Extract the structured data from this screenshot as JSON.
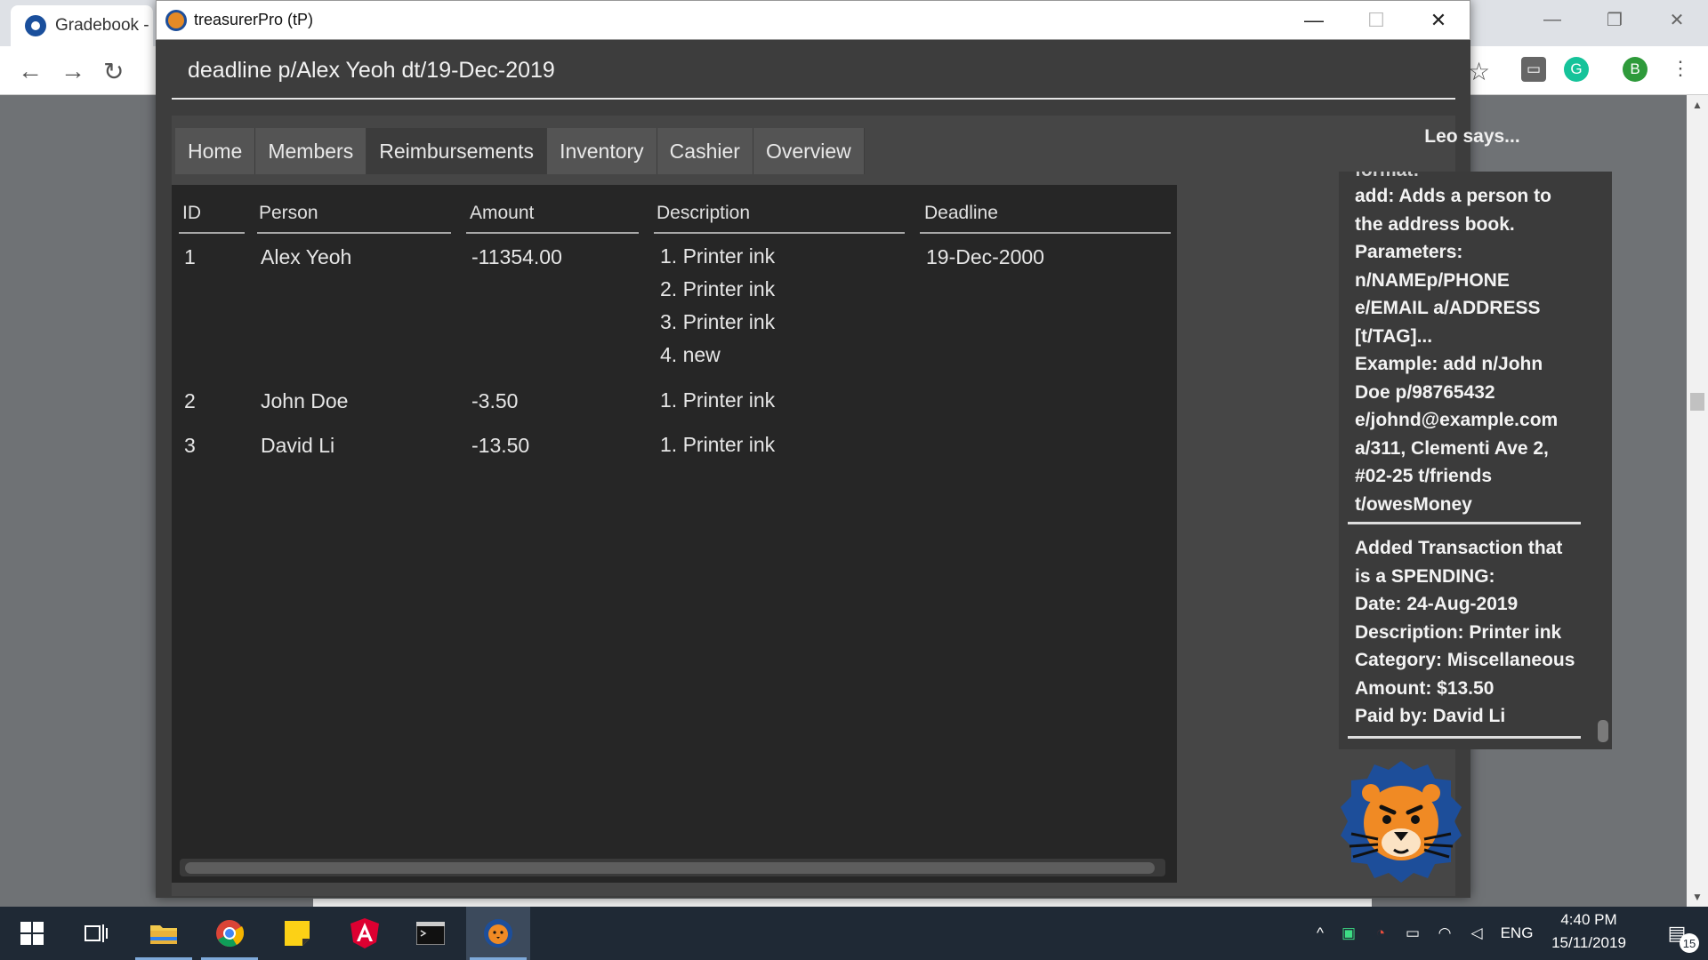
{
  "browser": {
    "tab_title": "Gradebook -",
    "profile_initial": "B"
  },
  "app": {
    "window_title": "treasurerPro (tP)",
    "command_value": "deadline p/Alex Yeoh dt/19-Dec-2019",
    "tabs": [
      {
        "label": "Home"
      },
      {
        "label": "Members"
      },
      {
        "label": "Reimbursements"
      },
      {
        "label": "Inventory"
      },
      {
        "label": "Cashier"
      },
      {
        "label": "Overview"
      }
    ],
    "active_tab": "Reimbursements",
    "table": {
      "headers": {
        "id": "ID",
        "person": "Person",
        "amount": "Amount",
        "description": "Description",
        "deadline": "Deadline"
      },
      "rows": [
        {
          "id": "1",
          "person": "Alex Yeoh",
          "amount": "-11354.00",
          "descriptions": [
            "1. Printer ink",
            "2. Printer ink",
            "3. Printer ink",
            "4. new"
          ],
          "deadline": "19-Dec-2000"
        },
        {
          "id": "2",
          "person": "John Doe",
          "amount": "-3.50",
          "descriptions": [
            "1. Printer ink"
          ],
          "deadline": ""
        },
        {
          "id": "3",
          "person": "David Li",
          "amount": "-13.50",
          "descriptions": [
            "1. Printer ink"
          ],
          "deadline": ""
        }
      ]
    },
    "chat": {
      "title": "Leo says...",
      "partial_line": "format:",
      "message1": [
        "add: Adds a person to",
        "the address book.",
        "Parameters:",
        "n/NAMEp/PHONE",
        "e/EMAIL a/ADDRESS",
        "[t/TAG]...",
        "Example: add n/John",
        "Doe p/98765432",
        "e/johnd@example.com",
        "a/311, Clementi Ave 2,",
        "#02-25 t/friends",
        "t/owesMoney"
      ],
      "message2": [
        "Added Transaction that",
        "is a SPENDING:",
        "Date: 24-Aug-2019",
        "Description: Printer ink",
        "Category: Miscellaneous",
        "Amount: $13.50",
        "Paid by: David Li"
      ]
    }
  },
  "taskbar": {
    "language": "ENG",
    "time": "4:40 PM",
    "date": "15/11/2019",
    "notification_count": "15"
  }
}
